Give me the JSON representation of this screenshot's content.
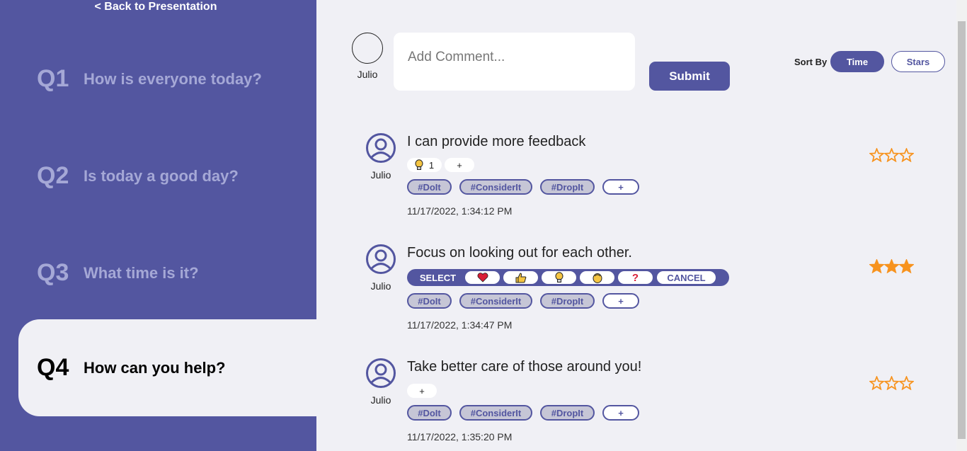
{
  "sidebar": {
    "back_label": "< Back to Presentation",
    "questions": [
      {
        "num": "Q1",
        "text": "How is everyone today?",
        "active": false
      },
      {
        "num": "Q2",
        "text": "Is today a good day?",
        "active": false
      },
      {
        "num": "Q3",
        "text": "What time is it?",
        "active": false
      },
      {
        "num": "Q4",
        "text": "How can you help?",
        "active": true
      }
    ]
  },
  "composer": {
    "user_name": "Julio",
    "placeholder": "Add Comment...",
    "submit_label": "Submit"
  },
  "sort": {
    "label": "Sort By",
    "time_label": "Time",
    "stars_label": "Stars",
    "selected": "Time"
  },
  "comments": [
    {
      "author": "Julio",
      "text": "I can provide more feedback",
      "reaction_count": "1",
      "add_reaction_label": "+",
      "tags": [
        "#DoIt",
        "#ConsiderIt",
        "#DropIt"
      ],
      "add_tag_label": "+",
      "timestamp": "11/17/2022, 1:34:12 PM",
      "stars_filled": 0,
      "stars_total": 3
    },
    {
      "author": "Julio",
      "text": "Focus on looking out for each other.",
      "select_label": "SELECT",
      "cancel_label": "CANCEL",
      "reaction_options": [
        "heart-icon",
        "thumbs-up-icon",
        "lightbulb-icon",
        "clap-icon",
        "question-icon"
      ],
      "tags": [
        "#DoIt",
        "#ConsiderIt",
        "#DropIt"
      ],
      "add_tag_label": "+",
      "timestamp": "11/17/2022, 1:34:47 PM",
      "stars_filled": 3,
      "stars_total": 3
    },
    {
      "author": "Julio",
      "text": "Take better care of those around you!",
      "add_reaction_label": "+",
      "tags": [
        "#DoIt",
        "#ConsiderIt",
        "#DropIt"
      ],
      "add_tag_label": "+",
      "timestamp": "11/17/2022, 1:35:20 PM",
      "stars_filled": 0,
      "stars_total": 3
    }
  ],
  "colors": {
    "primary": "#5356a0",
    "muted_question": "#a5a8d6",
    "background": "#f0f0f5",
    "star": "#f7931e"
  }
}
